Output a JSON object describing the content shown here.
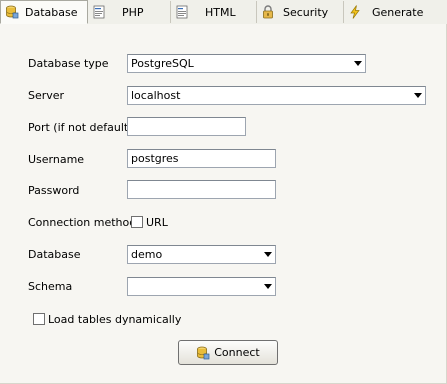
{
  "tabs": [
    {
      "label": "Database",
      "icon": "database-icon",
      "active": true
    },
    {
      "label": "PHP",
      "icon": "php-file-icon",
      "active": false
    },
    {
      "label": "HTML",
      "icon": "html-file-icon",
      "active": false
    },
    {
      "label": "Security",
      "icon": "lock-icon",
      "active": false
    },
    {
      "label": "Generate",
      "icon": "lightning-icon",
      "active": false
    }
  ],
  "form": {
    "database_type": {
      "label": "Database type",
      "value": "PostgreSQL"
    },
    "server": {
      "label": "Server",
      "value": "localhost"
    },
    "port": {
      "label": "Port (if not default)",
      "value": ""
    },
    "username": {
      "label": "Username",
      "value": "postgres"
    },
    "password": {
      "label": "Password",
      "value": ""
    },
    "connection_method": {
      "label": "Connection method",
      "checkbox_label": "URL",
      "checked": false
    },
    "database": {
      "label": "Database",
      "value": "demo"
    },
    "schema": {
      "label": "Schema",
      "value": ""
    },
    "load_tables": {
      "label": "Load tables dynamically",
      "checked": false
    }
  },
  "connect_button": {
    "label": "Connect",
    "icon": "database-icon"
  }
}
